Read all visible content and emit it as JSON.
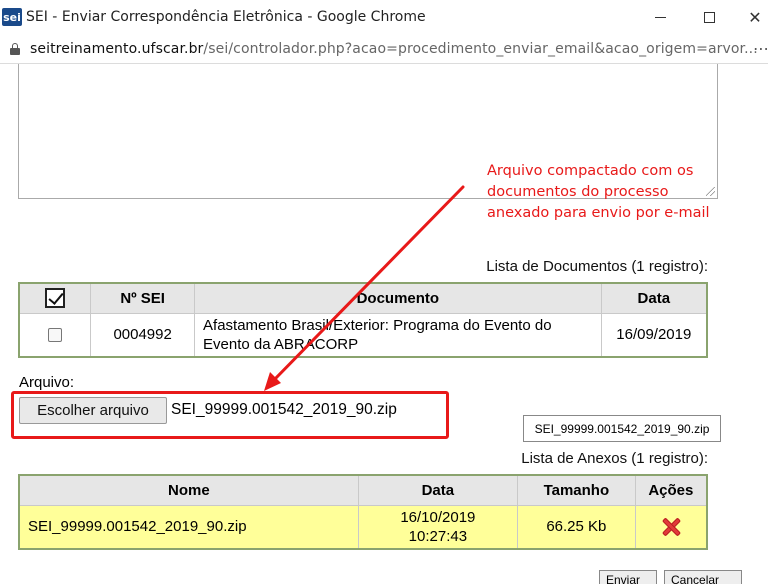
{
  "window": {
    "logo_text": "sei",
    "title": "SEI - Enviar Correspondência Eletrônica - Google Chrome",
    "minimize": "",
    "close": "✕"
  },
  "address": {
    "host": "seitreinamento.ufscar.br",
    "path": "/sei/controlador.php?acao=procedimento_enviar_email&acao_origem=arvor...",
    "more": "⋯"
  },
  "annotation": {
    "text": "Arquivo compactado com os\ndocumentos do processo\nanexado para envio por e-mail",
    "color": "#e81919"
  },
  "documents": {
    "caption": "Lista de Documentos (1 registro):",
    "headers": {
      "nsei": "Nº SEI",
      "documento": "Documento",
      "data": "Data"
    },
    "rows": [
      {
        "nsei": "0004992",
        "documento": "Afastamento Brasil/Exterior: Programa do Evento do Evento da ABRACORP",
        "data": "16/09/2019"
      }
    ]
  },
  "upload": {
    "label": "Arquivo:",
    "button": "Escolher arquivo",
    "chosen": "SEI_99999.001542_2019_90.zip",
    "tag": "SEI_99999.001542_2019_90.zip"
  },
  "attachments": {
    "caption": "Lista de Anexos (1 registro):",
    "headers": {
      "nome": "Nome",
      "data": "Data",
      "tamanho": "Tamanho",
      "acoes": "Ações"
    },
    "rows": [
      {
        "nome": "SEI_99999.001542_2019_90.zip",
        "date": "16/10/2019",
        "time": "10:27:43",
        "tamanho": "66.25 Kb"
      }
    ]
  },
  "footer": {
    "send": "Enviar",
    "cancel": "Cancelar"
  },
  "colors": {
    "annotation_red": "#e81919",
    "table_border_green": "#8aa36e",
    "attachment_row_yellow": "#ffff99",
    "header_gray": "#e6e6e6"
  }
}
